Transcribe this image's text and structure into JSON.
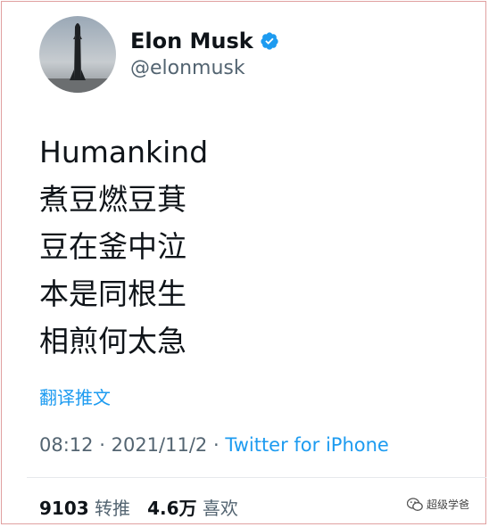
{
  "author": {
    "name": "Elon Musk",
    "handle": "@elonmusk",
    "verified": true
  },
  "tweet": {
    "lines": [
      "Humankind",
      "煮豆燃豆萁",
      "豆在釜中泣",
      "本是同根生",
      "相煎何太急"
    ],
    "translate_label": "翻译推文",
    "time": "08:12",
    "date": "2021/11/2",
    "separator": "·",
    "source": "Twitter for iPhone"
  },
  "stats": {
    "retweets_count": "9103",
    "retweets_label": "转推",
    "likes_count": "4.6万",
    "likes_label": "喜欢"
  },
  "watermark": {
    "text": "超级学爸"
  },
  "colors": {
    "accent": "#1d9bf0",
    "text": "#0f1419",
    "secondary": "#536471"
  }
}
